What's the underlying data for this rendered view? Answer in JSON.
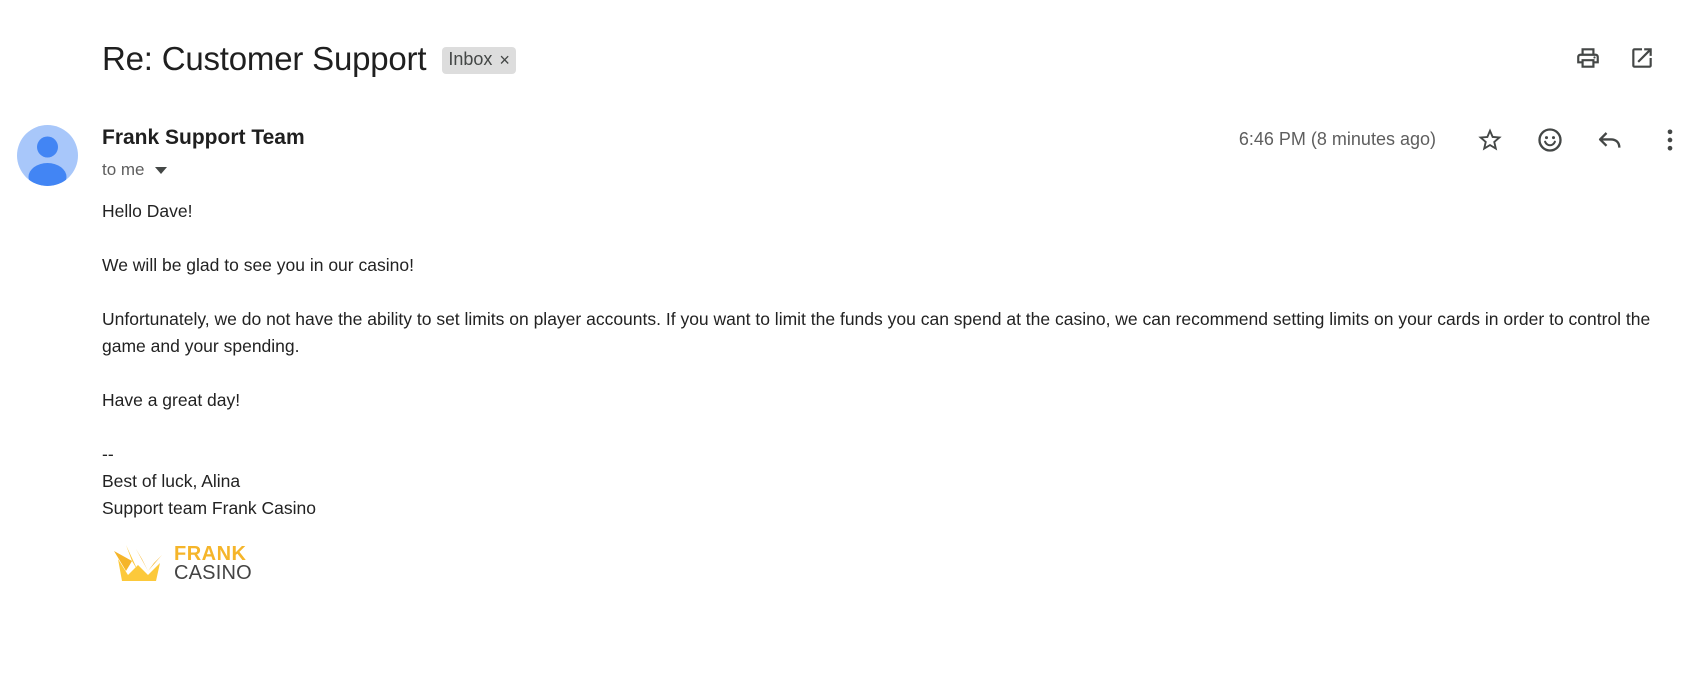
{
  "subject": "Re: Customer Support",
  "label": {
    "name": "Inbox",
    "remove_glyph": "×"
  },
  "toolbar": {
    "icons": [
      "print-icon",
      "open-in-new-window-icon"
    ]
  },
  "message": {
    "sender": "Frank Support Team",
    "recipient": "to me",
    "timestamp": "6:46 PM (8 minutes ago)",
    "actions": [
      "star-icon",
      "emoji-reaction-icon",
      "reply-icon",
      "more-options-icon"
    ],
    "body": {
      "greeting": "Hello Dave!",
      "para1": "We will be glad to see you in our casino!",
      "para2": "Unfortunately, we do not have the ability to set limits on player accounts. If you want to limit the funds you can spend at the casino, we can recommend setting limits on your cards in order to control the game and your spending.",
      "closing": "Have a great day!",
      "sig_separator": "--",
      "sig_line1": "Best of luck, Alina",
      "sig_line2": "Support team Frank Casino"
    },
    "logo": {
      "line1": "FRANK",
      "line2": "CASINO"
    }
  },
  "colors": {
    "avatar_bg": "#a8c7fa",
    "avatar_fg": "#4285f4",
    "logo_gold": "#f5b52a",
    "chip_bg": "#dddddd"
  }
}
